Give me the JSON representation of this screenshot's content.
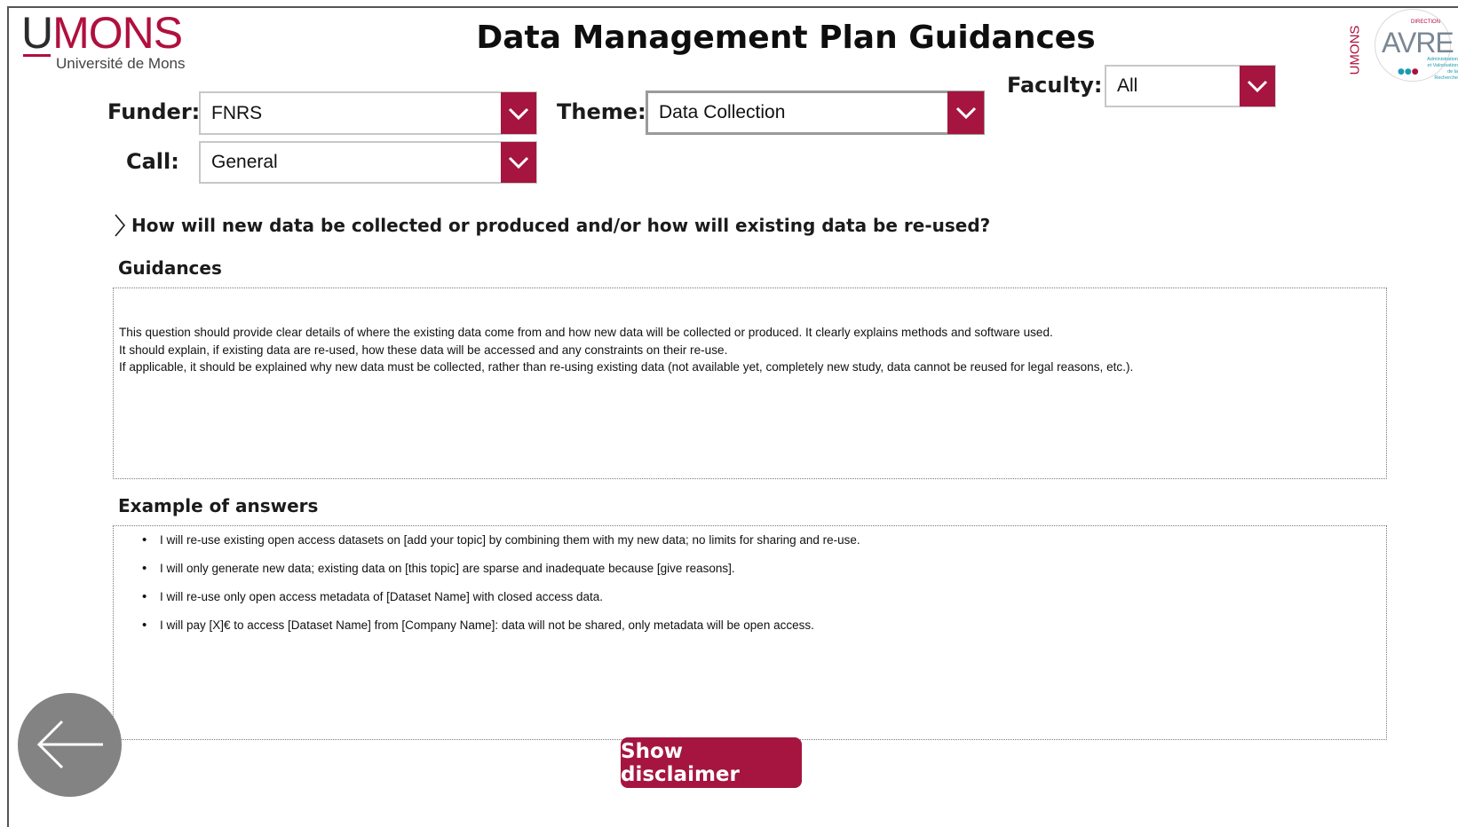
{
  "header": {
    "title": "Data Management Plan Guidances",
    "logo_left": {
      "name": "UMONS",
      "subtitle": "Université de Mons"
    },
    "logo_right": {
      "name": "AVRE",
      "vertical_text": "UMONS",
      "small_text": "DIRECTION",
      "tagline": [
        "Administration",
        "et Valorisation",
        "de la Recherche"
      ]
    }
  },
  "filters": {
    "funder": {
      "label": "Funder:",
      "value": "FNRS"
    },
    "theme": {
      "label": "Theme:",
      "value": "Data Collection"
    },
    "faculty": {
      "label": "Faculty:",
      "value": "All"
    },
    "call": {
      "label": "Call:",
      "value": "General"
    }
  },
  "question": {
    "icon": "chevron-right-icon",
    "text": "How will new data be collected or produced and/or how will existing data be re-used?"
  },
  "guidances": {
    "heading": "Guidances",
    "lines": [
      "This question should provide clear details of where the existing data come from and how new data will be collected or produced. It clearly explains methods and software used.",
      "It should explain, if existing data are re-used, how these data will be accessed and any constraints on their re-use.",
      "If applicable, it should be explained why new data must be collected, rather than re-using existing data (not available yet, completely new study, data cannot be reused for legal reasons, etc.)."
    ]
  },
  "examples": {
    "heading": "Example of answers",
    "items": [
      "I will re-use existing open access datasets on [add your topic] by combining them with my new data; no limits for sharing and re-use.",
      "I will only generate new data; existing data on [this topic] are sparse and inadequate because [give reasons].",
      "I will re-use only open access metadata of [Dataset Name] with closed access data.",
      "I will pay [X]€ to access [Dataset Name] from [Company Name]: data will not be shared, only metadata will be open access."
    ]
  },
  "buttons": {
    "back_icon": "arrow-left-icon",
    "disclaimer_label": "Show disclaimer"
  },
  "colors": {
    "accent": "#a51540",
    "back_button": "#838383"
  }
}
